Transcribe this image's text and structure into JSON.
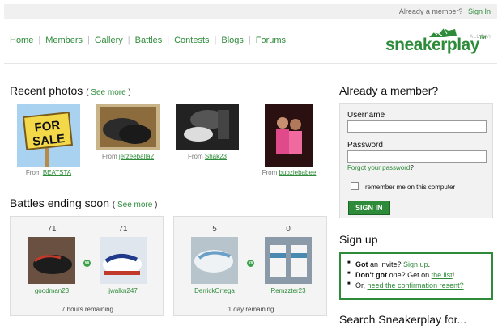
{
  "topbar": {
    "question": "Already a member?",
    "signin": "Sign In"
  },
  "nav": [
    "Home",
    "Members",
    "Gallery",
    "Battles",
    "Contests",
    "Blogs",
    "Forums"
  ],
  "logo": {
    "word": "sneakerplay",
    "tm": "TM",
    "tagline": "ALL DAY"
  },
  "recent": {
    "title": "Recent photos",
    "see_more": "See more",
    "from": "From",
    "items": [
      {
        "user": "BEATSTA"
      },
      {
        "user": "jerzeeballa2"
      },
      {
        "user": "Shak23"
      },
      {
        "user": "bubziebabee"
      }
    ],
    "sign_text": [
      "FOR",
      "SALE"
    ]
  },
  "battles": {
    "title": "Battles ending soon",
    "see_more": "See more",
    "list": [
      {
        "a": {
          "votes": "71",
          "user": "goodman23"
        },
        "b": {
          "votes": "71",
          "user": "jwalkn247"
        },
        "remaining": "7 hours remaining"
      },
      {
        "a": {
          "votes": "5",
          "user": "DerrickOrtega"
        },
        "b": {
          "votes": "0",
          "user": "Remzzter23"
        },
        "remaining": "1 day remaining"
      }
    ],
    "vs": "vs"
  },
  "login": {
    "title": "Already a member?",
    "username": "Username",
    "password": "Password",
    "forgot": "Forgot your password",
    "forgot_q": "?",
    "remember": "remember me on this computer",
    "button": "SIGN IN"
  },
  "signup": {
    "title": "Sign up",
    "line1": {
      "bold": "Got",
      "text": " an invite? ",
      "link": "Sign up",
      "end": "."
    },
    "line2": {
      "bold": "Don't got",
      "text": " one? Get on ",
      "link": "the list",
      "end": "!"
    },
    "line3": {
      "text": "Or, ",
      "link": "need the confirmation resent?"
    }
  },
  "search": {
    "title": "Search Sneakerplay for..."
  },
  "colors": {
    "brand": "#2e8b3a"
  }
}
